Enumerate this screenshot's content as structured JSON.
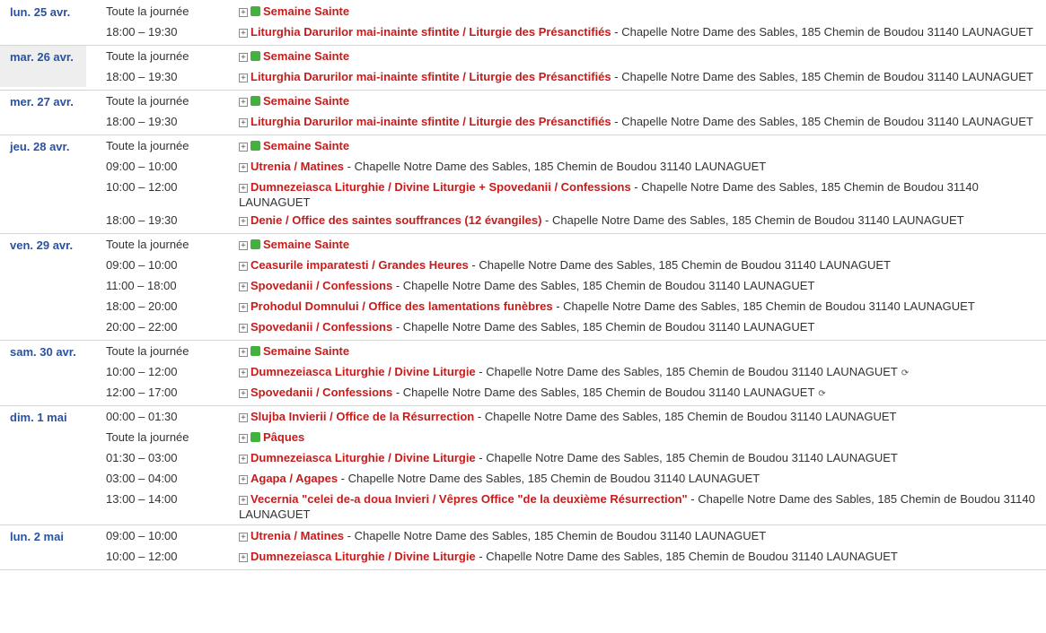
{
  "colors": {
    "date": "#2952a3",
    "title": "#c61c1c",
    "allday_chip": "#43b13e",
    "today_bg": "#eeeeee"
  },
  "icons": {
    "expand": "plus-box-icon",
    "allday": "green-square-icon",
    "repeat": "repeat-icon"
  },
  "days": [
    {
      "date": "lun. 25 avr.",
      "today": false,
      "events": [
        {
          "time": "Toute la journée",
          "allday": true,
          "title": "Semaine Sainte",
          "sep": "",
          "location": ""
        },
        {
          "time": "18:00 – 19:30",
          "allday": false,
          "title": "Liturghia Darurilor mai-inainte sfintite / Liturgie des Présanctifiés",
          "sep": " - ",
          "location": "Chapelle Notre Dame des Sables, 185 Chemin de Boudou 31140 LAUNAGUET"
        }
      ]
    },
    {
      "date": "mar. 26 avr.",
      "today": true,
      "events": [
        {
          "time": "Toute la journée",
          "allday": true,
          "title": "Semaine Sainte",
          "sep": "",
          "location": ""
        },
        {
          "time": "18:00 – 19:30",
          "allday": false,
          "title": "Liturghia Darurilor mai-inainte sfintite / Liturgie des Présanctifiés",
          "sep": " - ",
          "location": "Chapelle Notre Dame des Sables, 185 Chemin de Boudou 31140 LAUNAGUET"
        }
      ]
    },
    {
      "date": "mer. 27 avr.",
      "today": false,
      "events": [
        {
          "time": "Toute la journée",
          "allday": true,
          "title": "Semaine Sainte",
          "sep": "",
          "location": ""
        },
        {
          "time": "18:00 – 19:30",
          "allday": false,
          "title": "Liturghia Darurilor mai-inainte sfintite / Liturgie des Présanctifiés",
          "sep": " - ",
          "location": "Chapelle Notre Dame des Sables, 185 Chemin de Boudou 31140 LAUNAGUET"
        }
      ]
    },
    {
      "date": "jeu. 28 avr.",
      "today": false,
      "events": [
        {
          "time": "Toute la journée",
          "allday": true,
          "title": "Semaine Sainte",
          "sep": "",
          "location": ""
        },
        {
          "time": "09:00 – 10:00",
          "allday": false,
          "title": "Utrenia / Matines",
          "sep": " - ",
          "location": "Chapelle Notre Dame des Sables, 185 Chemin de Boudou 31140 LAUNAGUET"
        },
        {
          "time": "10:00 – 12:00",
          "allday": false,
          "title": "Dumnezeiasca Liturghie / Divine Liturgie + Spovedanii / Confessions",
          "sep": " - ",
          "location": "Chapelle Notre Dame des Sables, 185 Chemin de Boudou 31140 LAUNAGUET"
        },
        {
          "time": "18:00 – 19:30",
          "allday": false,
          "title": "Denie / Office des saintes souffrances (12 évangiles)",
          "sep": " - ",
          "location": "Chapelle Notre Dame des Sables, 185 Chemin de Boudou 31140 LAUNAGUET"
        }
      ]
    },
    {
      "date": "ven. 29 avr.",
      "today": false,
      "events": [
        {
          "time": "Toute la journée",
          "allday": true,
          "title": "Semaine Sainte",
          "sep": "",
          "location": ""
        },
        {
          "time": "09:00 – 10:00",
          "allday": false,
          "title": "Ceasurile imparatesti / Grandes Heures",
          "sep": " - ",
          "location": "Chapelle Notre Dame des Sables, 185 Chemin de Boudou 31140 LAUNAGUET"
        },
        {
          "time": "11:00 – 18:00",
          "allday": false,
          "title": "Spovedanii / Confessions",
          "sep": " - ",
          "location": "Chapelle Notre Dame des Sables, 185 Chemin de Boudou 31140 LAUNAGUET"
        },
        {
          "time": "18:00 – 20:00",
          "allday": false,
          "title": "Prohodul Domnului / Office des lamentations funèbres",
          "sep": " - ",
          "location": "Chapelle Notre Dame des Sables, 185 Chemin de Boudou 31140 LAUNAGUET"
        },
        {
          "time": "20:00 – 22:00",
          "allday": false,
          "title": "Spovedanii / Confessions",
          "sep": " - ",
          "location": "Chapelle Notre Dame des Sables, 185 Chemin de Boudou 31140 LAUNAGUET"
        }
      ]
    },
    {
      "date": "sam. 30 avr.",
      "today": false,
      "events": [
        {
          "time": "Toute la journée",
          "allday": true,
          "title": "Semaine Sainte",
          "sep": "",
          "location": ""
        },
        {
          "time": "10:00 – 12:00",
          "allday": false,
          "repeat": true,
          "title": "Dumnezeiasca Liturghie / Divine Liturgie",
          "sep": " - ",
          "location": "Chapelle Notre Dame des Sables, 185 Chemin de Boudou 31140 LAUNAGUET"
        },
        {
          "time": "12:00 – 17:00",
          "allday": false,
          "repeat": true,
          "title": "Spovedanii / Confessions",
          "sep": " - ",
          "location": "Chapelle Notre Dame des Sables, 185 Chemin de Boudou 31140 LAUNAGUET"
        }
      ]
    },
    {
      "date": "dim. 1 mai",
      "today": false,
      "events": [
        {
          "time": "00:00 – 01:30",
          "allday": false,
          "title": "Slujba Invierii / Office de la Résurrection",
          "sep": " - ",
          "location": "Chapelle Notre Dame des Sables, 185 Chemin de Boudou 31140 LAUNAGUET"
        },
        {
          "time": "Toute la journée",
          "allday": true,
          "title": "Pâques",
          "sep": "",
          "location": ""
        },
        {
          "time": "01:30 – 03:00",
          "allday": false,
          "title": "Dumnezeiasca Liturghie / Divine Liturgie",
          "sep": " - ",
          "location": "Chapelle Notre Dame des Sables, 185 Chemin de Boudou 31140 LAUNAGUET"
        },
        {
          "time": "03:00 – 04:00",
          "allday": false,
          "title": "Agapa / Agapes",
          "sep": " - ",
          "location": "Chapelle Notre Dame des Sables, 185 Chemin de Boudou 31140 LAUNAGUET"
        },
        {
          "time": "13:00 – 14:00",
          "allday": false,
          "title": "Vecernia \"celei de-a doua Invieri / Vêpres Office \"de la deuxième Résurrection\"",
          "sep": " - ",
          "location": "Chapelle Notre Dame des Sables, 185 Chemin de Boudou 31140 LAUNAGUET"
        }
      ]
    },
    {
      "date": "lun. 2 mai",
      "today": false,
      "events": [
        {
          "time": "09:00 – 10:00",
          "allday": false,
          "title": "Utrenia / Matines",
          "sep": " - ",
          "location": "Chapelle Notre Dame des Sables, 185 Chemin de Boudou 31140 LAUNAGUET"
        },
        {
          "time": "10:00 – 12:00",
          "allday": false,
          "title": "Dumnezeiasca Liturghie / Divine Liturgie",
          "sep": " - ",
          "location": "Chapelle Notre Dame des Sables, 185 Chemin de Boudou 31140 LAUNAGUET"
        }
      ]
    }
  ]
}
